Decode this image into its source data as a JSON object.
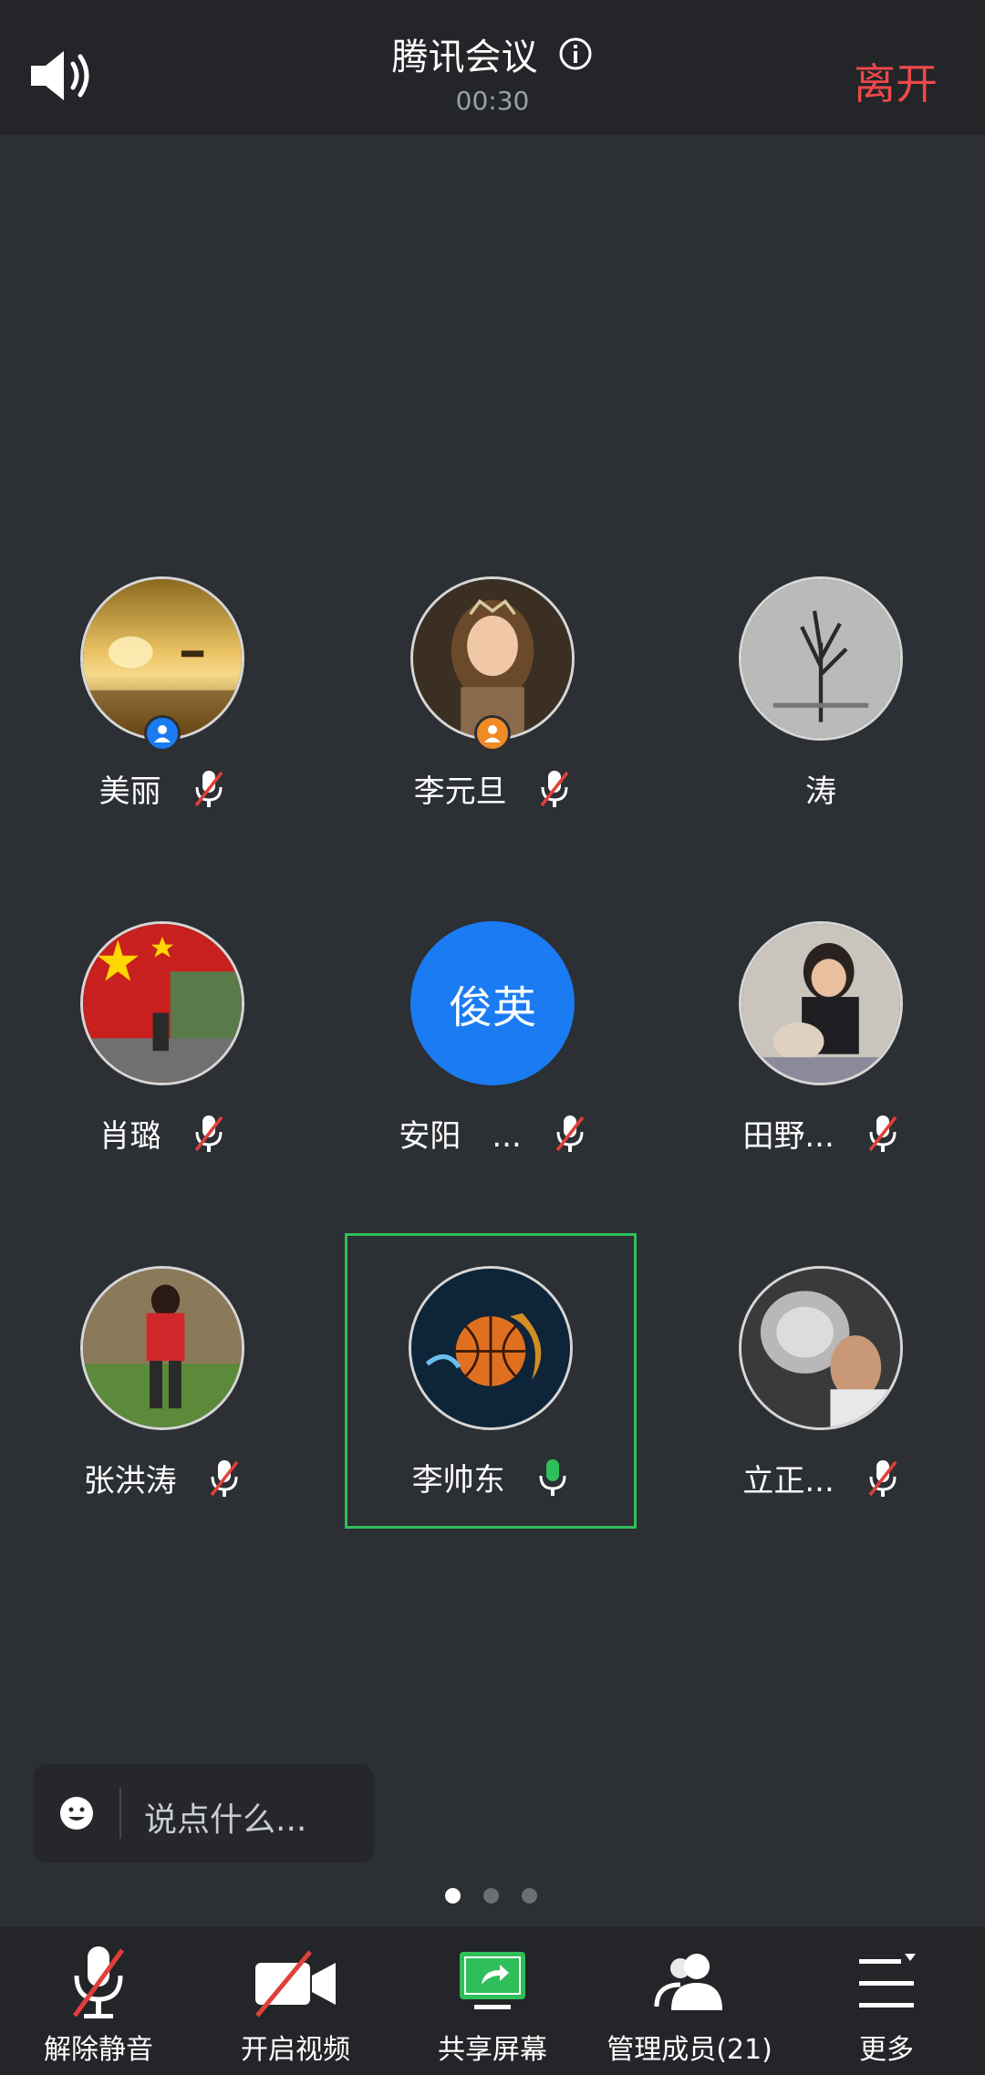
{
  "header": {
    "title": "腾讯会议",
    "timer": "00:30",
    "leave_label": "离开",
    "speaker_icon": "speaker-icon",
    "info_icon": "info-icon"
  },
  "participants": [
    {
      "name": "美丽",
      "mic": "muted",
      "host_badge": "blue"
    },
    {
      "name": "李元旦",
      "mic": "muted",
      "host_badge": "orange"
    },
    {
      "name": "涛",
      "mic": "none"
    },
    {
      "name": "肖璐",
      "mic": "muted"
    },
    {
      "name": "安阳　...",
      "mic": "muted",
      "avatar_text": "俊英"
    },
    {
      "name": "田野...",
      "mic": "muted"
    },
    {
      "name": "张洪涛",
      "mic": "muted"
    },
    {
      "name": "李帅东",
      "mic": "active",
      "active_speaker": true
    },
    {
      "name": "立正...",
      "mic": "muted"
    }
  ],
  "chat": {
    "placeholder": "说点什么..."
  },
  "pagination": {
    "pages": 3,
    "current": 1
  },
  "toolbar": {
    "unmute": "解除静音",
    "video": "开启视频",
    "share": "共享屏幕",
    "members": "管理成员(21)",
    "more": "更多"
  },
  "colors": {
    "background": "#2c2f33",
    "bar": "#232528",
    "leave": "#f0484a",
    "active_border": "#2fbf5a",
    "avatar_blue": "#1a7bf2",
    "share_green": "#2fbf5a"
  }
}
